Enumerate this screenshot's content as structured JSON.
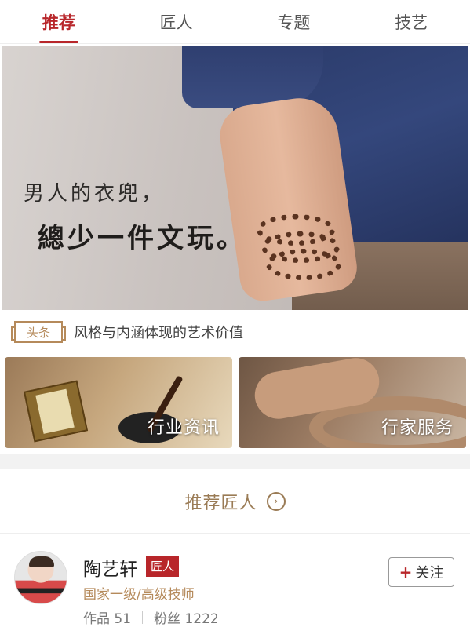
{
  "tabs": [
    {
      "label": "推荐",
      "active": true
    },
    {
      "label": "匠人",
      "active": false
    },
    {
      "label": "专题",
      "active": false
    },
    {
      "label": "技艺",
      "active": false
    }
  ],
  "banner": {
    "line1": "男人的衣兜，",
    "line2": "總少一件文玩。"
  },
  "headline": {
    "badge": "头条",
    "text": "风格与内涵体现的艺术价值"
  },
  "cards": [
    {
      "label": "行业资讯"
    },
    {
      "label": "行家服务"
    }
  ],
  "recommend": {
    "title": "推荐匠人",
    "arrow_icon": "chevron-right-circle-icon"
  },
  "artisan": {
    "name": "陶艺轩",
    "badge": "匠人",
    "title": "国家一级/高级技师",
    "works": "作品 51",
    "fans": "粉丝 1222",
    "follow_label": "关注",
    "follow_plus": "+"
  },
  "colors": {
    "accent": "#b8262a",
    "gold": "#b58a5b"
  }
}
